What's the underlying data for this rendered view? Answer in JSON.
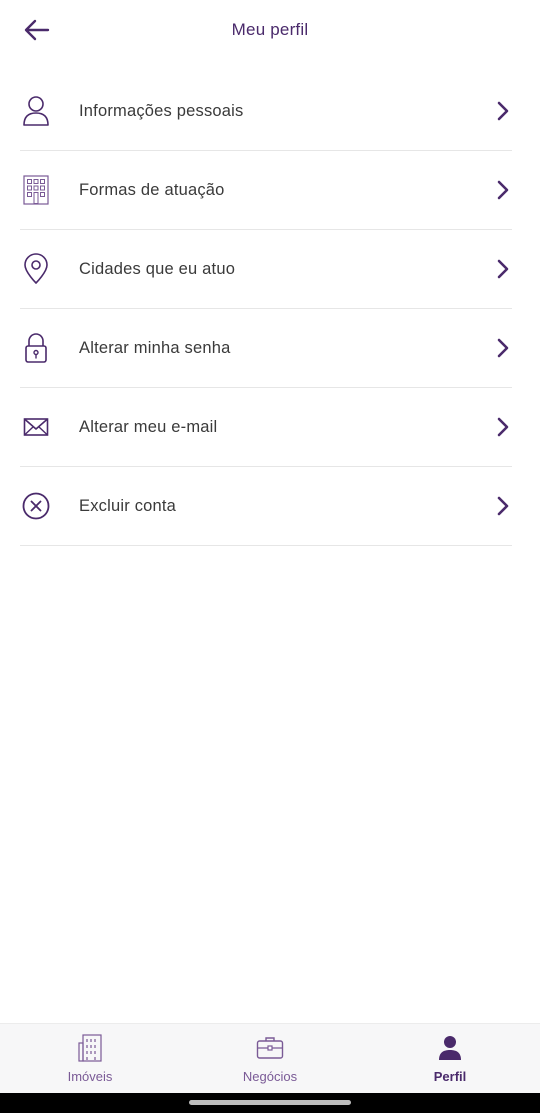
{
  "header": {
    "title": "Meu perfil"
  },
  "menu": {
    "items": [
      {
        "icon": "user-icon",
        "label": "Informações pessoais"
      },
      {
        "icon": "building-icon",
        "label": "Formas de atuação"
      },
      {
        "icon": "map-pin-icon",
        "label": "Cidades que eu atuo"
      },
      {
        "icon": "lock-icon",
        "label": "Alterar minha senha"
      },
      {
        "icon": "mail-icon",
        "label": "Alterar meu e-mail"
      },
      {
        "icon": "close-circle-icon",
        "label": "Excluir conta"
      }
    ]
  },
  "bottom_nav": {
    "items": [
      {
        "icon": "building-icon",
        "label": "Imóveis",
        "active": false
      },
      {
        "icon": "briefcase-icon",
        "label": "Negócios",
        "active": false
      },
      {
        "icon": "user-filled-icon",
        "label": "Perfil",
        "active": true
      }
    ]
  },
  "colors": {
    "accent": "#4a2a6b",
    "icon_light": "#7a5a96",
    "divider": "#e6e6e6",
    "nav_background": "#f7f7f8"
  }
}
